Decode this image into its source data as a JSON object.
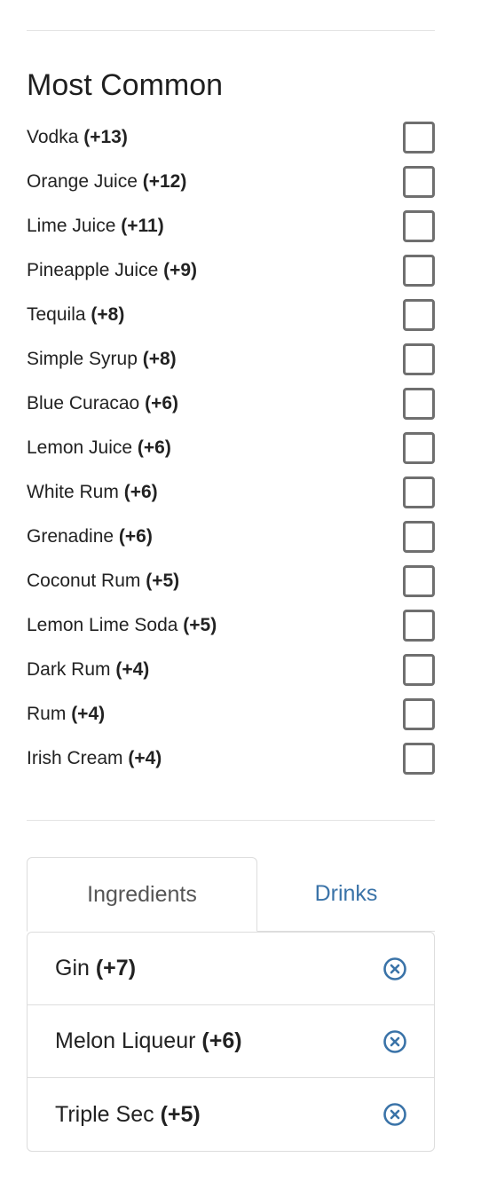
{
  "most_common": {
    "title": "Most Common",
    "items": [
      {
        "name": "Vodka",
        "count": "(+13)"
      },
      {
        "name": "Orange Juice",
        "count": "(+12)"
      },
      {
        "name": "Lime Juice",
        "count": "(+11)"
      },
      {
        "name": "Pineapple Juice",
        "count": "(+9)"
      },
      {
        "name": "Tequila",
        "count": "(+8)"
      },
      {
        "name": "Simple Syrup",
        "count": "(+8)"
      },
      {
        "name": "Blue Curacao",
        "count": "(+6)"
      },
      {
        "name": "Lemon Juice",
        "count": "(+6)"
      },
      {
        "name": "White Rum",
        "count": "(+6)"
      },
      {
        "name": "Grenadine",
        "count": "(+6)"
      },
      {
        "name": "Coconut Rum",
        "count": "(+5)"
      },
      {
        "name": "Lemon Lime Soda",
        "count": "(+5)"
      },
      {
        "name": "Dark Rum",
        "count": "(+4)"
      },
      {
        "name": "Rum",
        "count": "(+4)"
      },
      {
        "name": "Irish Cream",
        "count": "(+4)"
      }
    ]
  },
  "tabs": {
    "ingredients_label": "Ingredients",
    "drinks_label": "Drinks",
    "active": "Ingredients"
  },
  "selected": {
    "items": [
      {
        "name": "Gin",
        "count": "(+7)"
      },
      {
        "name": "Melon Liqueur",
        "count": "(+6)"
      },
      {
        "name": "Triple Sec",
        "count": "(+5)"
      }
    ]
  },
  "colors": {
    "accent": "#3a73a8",
    "checkbox_border": "#6f6f6f"
  },
  "icons": {
    "remove": "circle-x-icon"
  }
}
